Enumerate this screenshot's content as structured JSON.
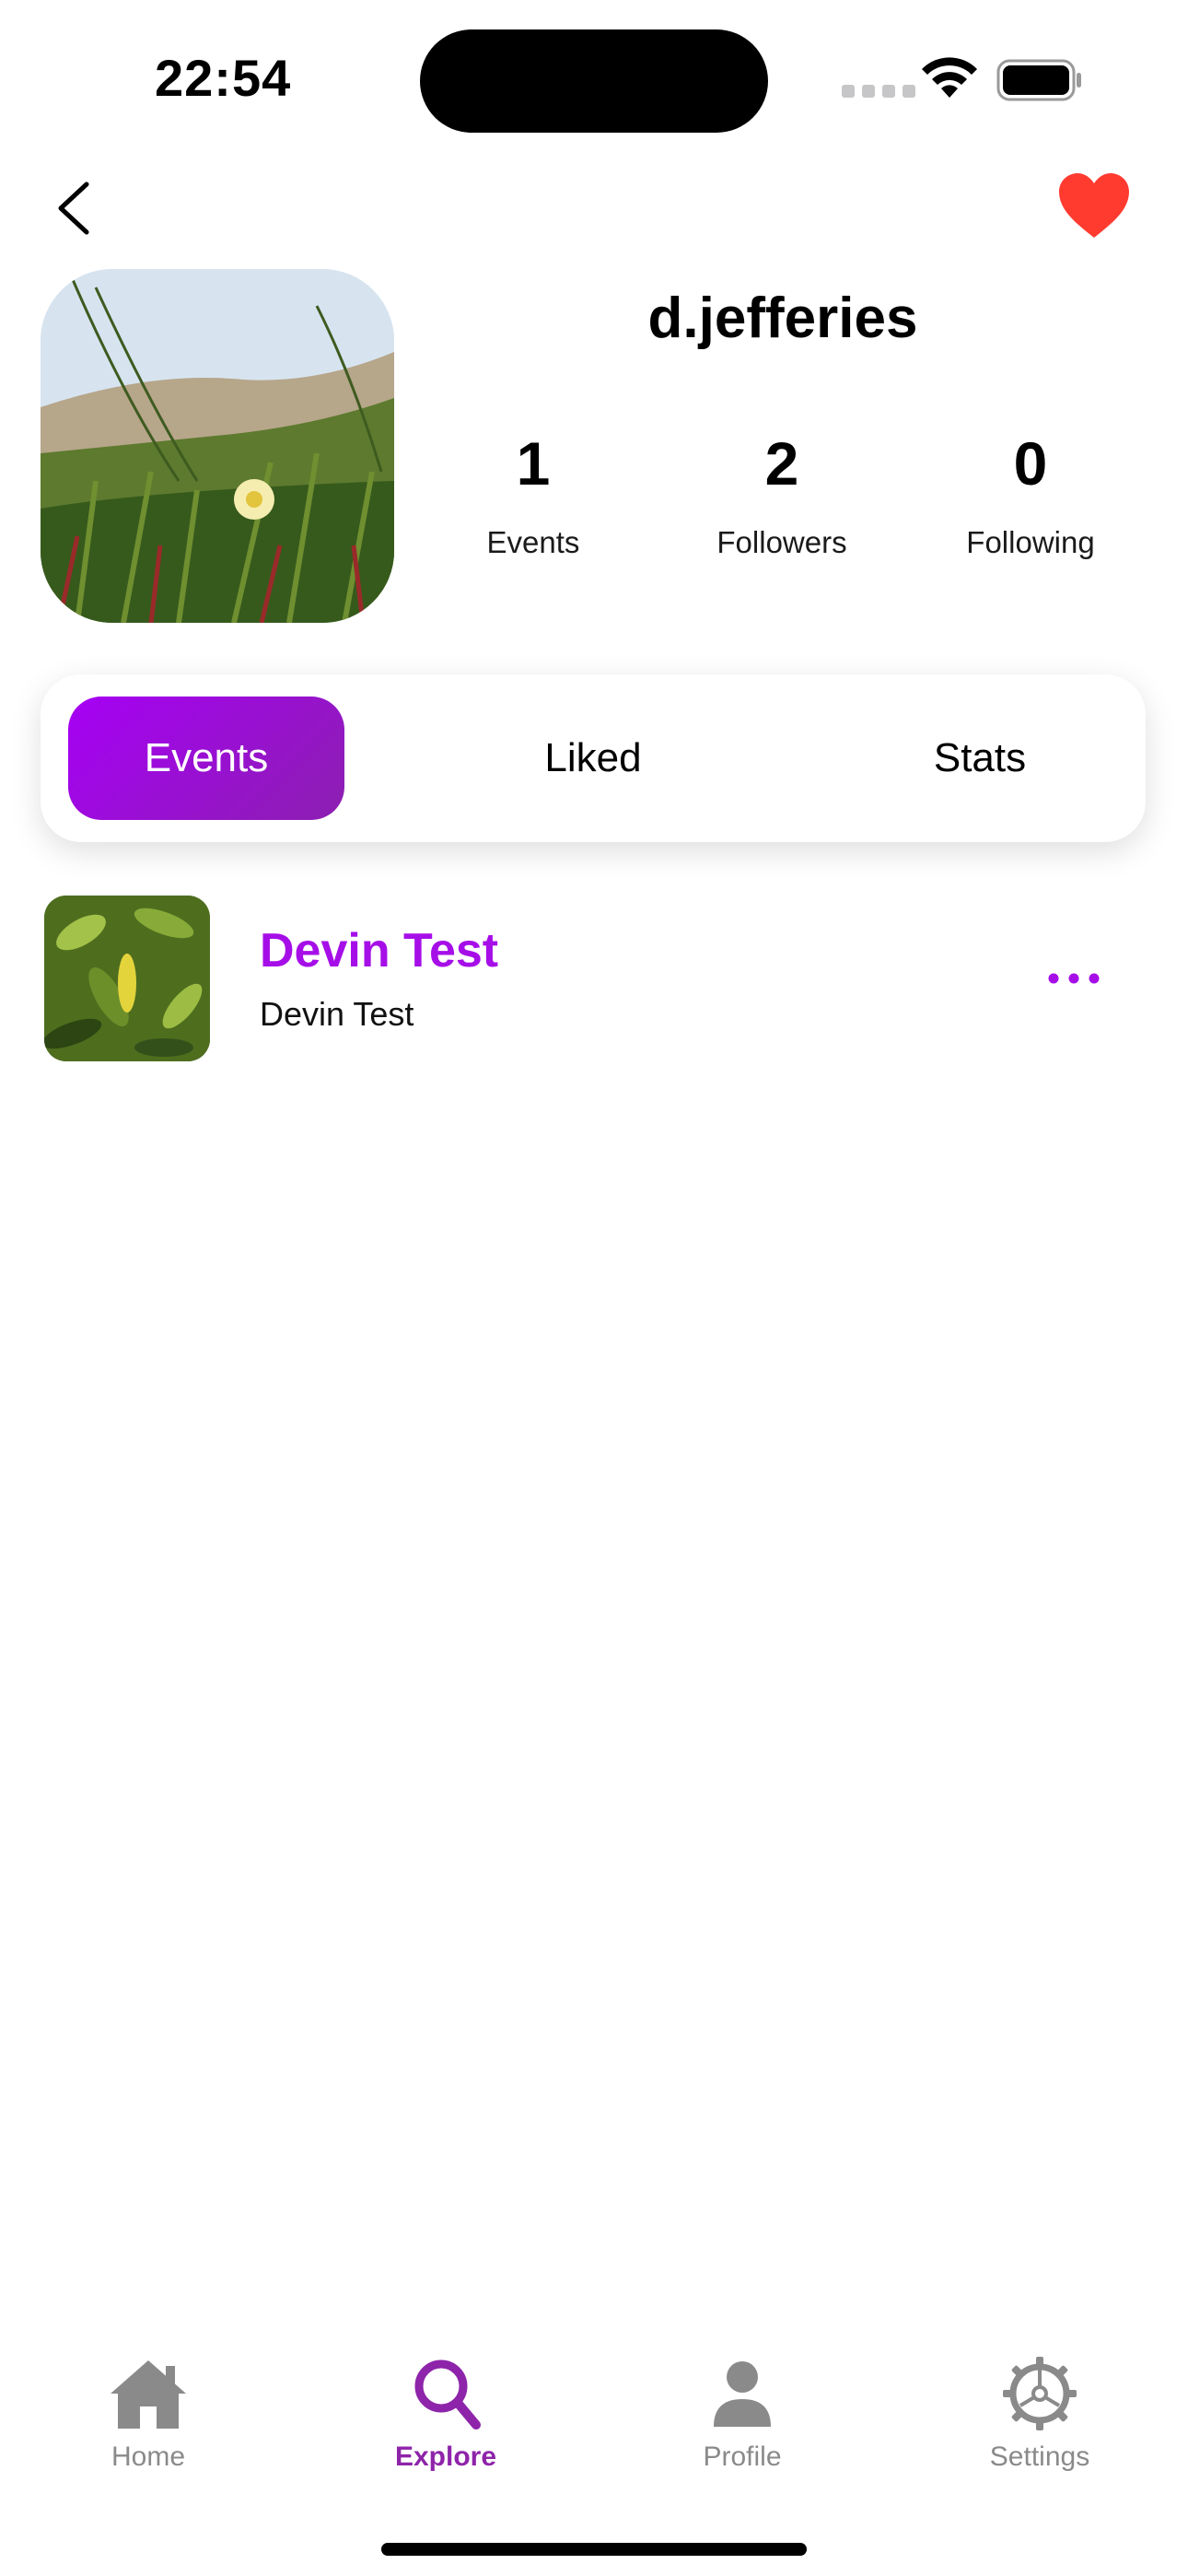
{
  "status_bar": {
    "time": "22:54"
  },
  "profile": {
    "username": "d.jefferies",
    "stats": [
      {
        "value": "1",
        "label": "Events"
      },
      {
        "value": "2",
        "label": "Followers"
      },
      {
        "value": "0",
        "label": "Following"
      }
    ]
  },
  "segments": {
    "items": [
      "Events",
      "Liked",
      "Stats"
    ],
    "selected": "Events"
  },
  "events": [
    {
      "title": "Devin Test",
      "subtitle": "Devin Test"
    }
  ],
  "tab_bar": {
    "items": [
      {
        "label": "Home",
        "icon": "home-icon"
      },
      {
        "label": "Explore",
        "icon": "search-icon"
      },
      {
        "label": "Profile",
        "icon": "person-icon"
      },
      {
        "label": "Settings",
        "icon": "gear-icon"
      }
    ],
    "active": "Explore"
  },
  "colors": {
    "accent": "#a600f5",
    "accent_text": "#a60ee8",
    "tab_active": "#8e24aa",
    "tab_inactive": "#8a8a8a",
    "heart": "#ff3b30"
  }
}
